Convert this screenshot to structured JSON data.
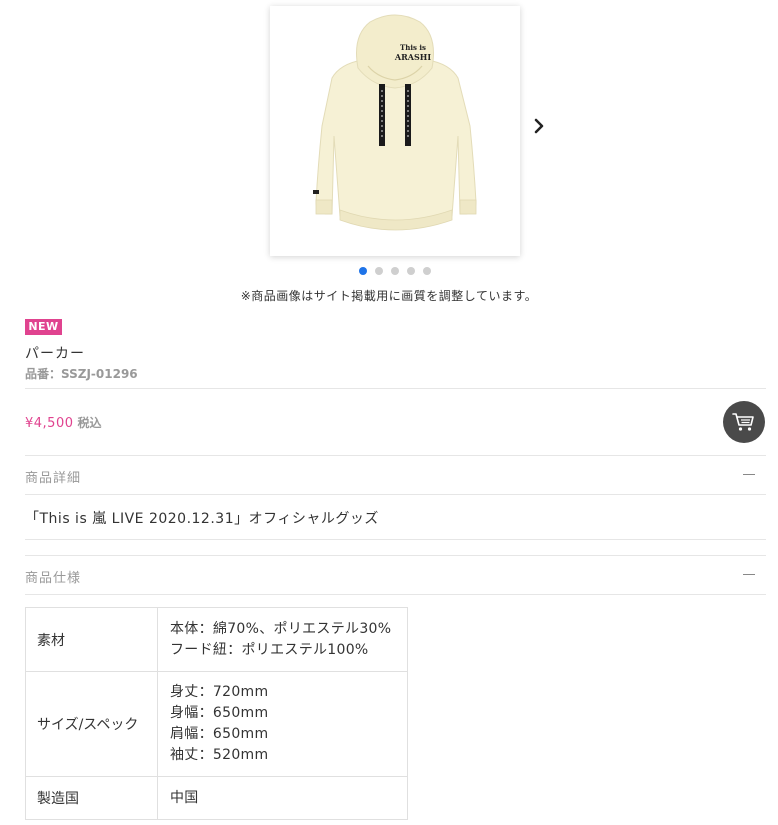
{
  "gallery": {
    "note": "※商品画像はサイト掲載用に画質を調整しています。",
    "hoodie_print": {
      "line1": "This is",
      "line2": "ARASHI"
    },
    "dots": [
      {
        "active": true
      },
      {
        "active": false
      },
      {
        "active": false
      },
      {
        "active": false
      },
      {
        "active": false
      }
    ]
  },
  "product": {
    "badge": "NEW",
    "name": "パーカー",
    "sku": "品番：SSZJ-01296",
    "price": "¥4,500",
    "tax_label": "税込"
  },
  "details": {
    "title": "商品詳細",
    "text": "「This is 嵐 LIVE 2020.12.31」オフィシャルグッズ"
  },
  "specs": {
    "title": "商品仕様",
    "rows": [
      {
        "label": "素材",
        "lines": [
          "本体：綿70%、ポリエステル30%",
          "フード紐：ポリエステル100%"
        ]
      },
      {
        "label": "サイズ/スペック",
        "lines": [
          "身丈：720mm",
          "身幅：650mm",
          "肩幅：650mm",
          "袖丈：520mm"
        ]
      },
      {
        "label": "製造国",
        "lines": [
          "中国"
        ]
      }
    ]
  },
  "colors": {
    "accent_pink": "#e0438f",
    "dot_active": "#1e73e8",
    "hoodie": "#f6f1d5",
    "cart_bg": "#4a4a4a"
  },
  "icons": {
    "next": "chevron-right-icon",
    "cart": "cart-icon",
    "collapse": "minus-icon"
  }
}
